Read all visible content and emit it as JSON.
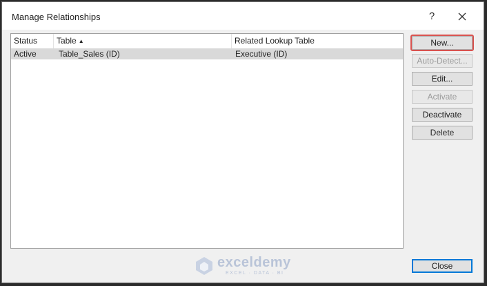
{
  "dialog": {
    "title": "Manage Relationships",
    "help_label": "?",
    "close_icon": "close-icon"
  },
  "list": {
    "columns": [
      {
        "label": "Status"
      },
      {
        "label": "Table",
        "sort": "ascending"
      },
      {
        "label": "Related Lookup Table"
      }
    ],
    "rows": [
      {
        "status": "Active",
        "table": "Table_Sales (ID)",
        "related": "Executive (ID)",
        "selected": true
      }
    ]
  },
  "buttons": {
    "new": "New...",
    "auto_detect": "Auto-Detect...",
    "edit": "Edit...",
    "activate": "Activate",
    "deactivate": "Deactivate",
    "delete": "Delete",
    "close": "Close"
  },
  "watermark": {
    "name": "exceldemy",
    "tagline": "EXCEL · DATA · BI"
  },
  "colors": {
    "highlight": "#d9534f",
    "selected_row": "#d9d9d9",
    "default_button": "#0078d7"
  }
}
